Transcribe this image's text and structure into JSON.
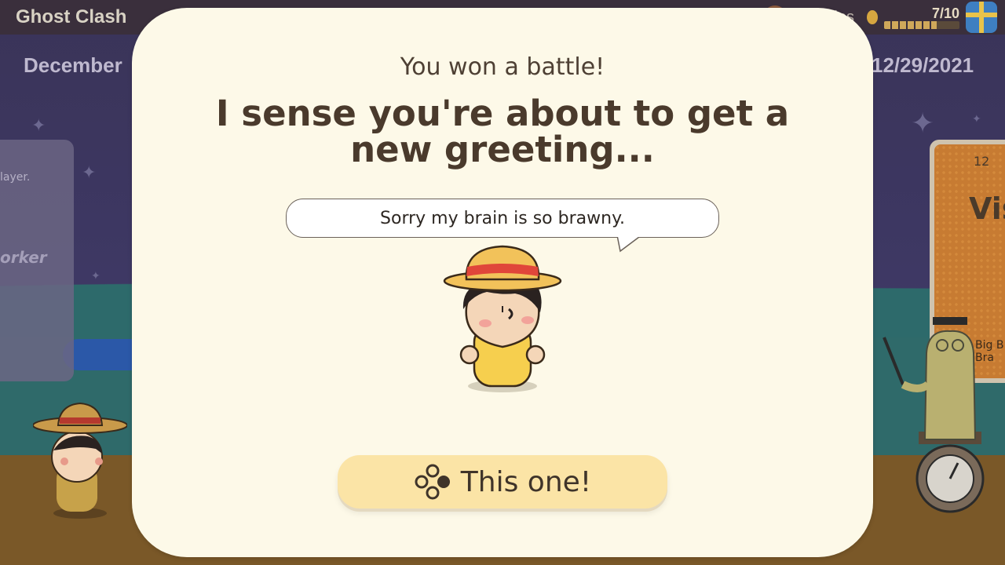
{
  "header": {
    "game_title": "Ghost Clash",
    "currency_name": "Portallos",
    "progress_text": "7/10",
    "progress_value": 0.7
  },
  "dates": {
    "left": "December",
    "right": "12/29/2021"
  },
  "cards": {
    "left_line1": "layer.",
    "left_line2": "orker",
    "right_number": "12",
    "right_title": "Vis",
    "right_label_line1": "Big B",
    "right_label_line2": "Bra"
  },
  "dialog": {
    "subtitle": "You won a battle!",
    "headline": "I sense you're about to get a new greeting...",
    "greeting": "Sorry my brain is so brawny.",
    "button_label": "This one!",
    "button_icon": "controller-buttons-icon"
  },
  "colors": {
    "dialog_bg": "#fdf9e8",
    "button_bg": "#fbe4a6",
    "text_dark": "#4a3a2c",
    "hat": "#f2c25a",
    "hat_band": "#e0463a",
    "shirt": "#f6cf4e"
  }
}
